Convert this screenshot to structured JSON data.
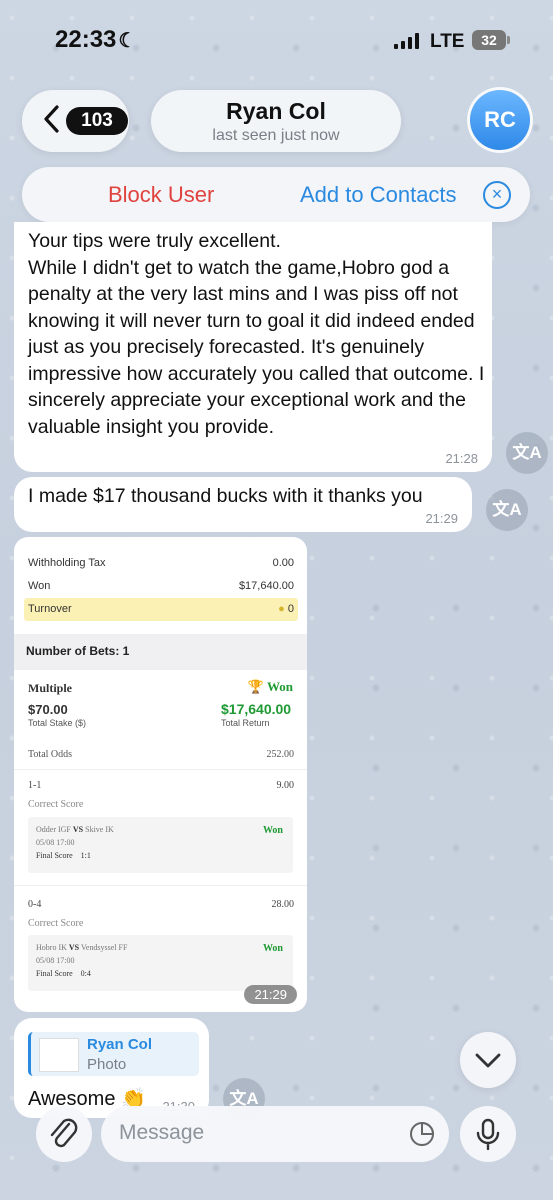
{
  "status_bar": {
    "time": "22:33",
    "network": "LTE",
    "battery": "32"
  },
  "header": {
    "back_count": "103",
    "name": "Ryan Col",
    "status": "last seen just now",
    "avatar_initials": "RC"
  },
  "action_bar": {
    "block": "Block User",
    "add": "Add to Contacts"
  },
  "messages": [
    {
      "text": "Your tips were truly excellent.\nWhile I didn't get to watch the game,Hobro god a penalty at the very last mins and I was piss off not knowing it will never turn to goal it did indeed ended just as you precisely forecasted. It's genuinely impressive how accurately you called that outcome. I sincerely appreciate your exceptional work and the valuable insight you provide.",
      "time": "21:28"
    },
    {
      "text": "I made $17 thousand bucks with it thanks you",
      "time": "21:29"
    }
  ],
  "translate_icon": "translate-icon",
  "receipt": {
    "withholding_label": "Withholding Tax",
    "withholding_value": "0.00",
    "won_label": "Won",
    "won_value": "$17,640.00",
    "turnover_label": "Turnover",
    "turnover_value": "0",
    "num_bets": "Number of Bets: 1",
    "multiple": "Multiple",
    "won_badge": "Won",
    "stake": "$70.00",
    "stake_label": "Total Stake ($)",
    "return": "$17,640.00",
    "return_label": "Total Return",
    "total_odds_label": "Total Odds",
    "total_odds_value": "252.00",
    "bets": [
      {
        "pick": "1-1",
        "odds": "9.00",
        "market": "Correct Score",
        "home": "Odder IGF",
        "vs": "VS",
        "away": "Skive IK",
        "date": "05/08 17:00",
        "final_label": "Final Score",
        "final": "1:1",
        "result": "Won"
      },
      {
        "pick": "0-4",
        "odds": "28.00",
        "market": "Correct Score",
        "home": "Hobro IK",
        "vs": "VS",
        "away": "Vendsyssel FF",
        "date": "05/08 17:00",
        "final_label": "Final Score",
        "final": "0:4",
        "result": "Won"
      }
    ],
    "time": "21:29"
  },
  "reply": {
    "name": "Ryan Col",
    "type": "Photo",
    "text": "Awesome 👏",
    "time": "21:30"
  },
  "input": {
    "placeholder": "Message"
  },
  "colors": {
    "accent": "#2a8ae0",
    "danger": "#e0433e",
    "won": "#1f9a33"
  }
}
